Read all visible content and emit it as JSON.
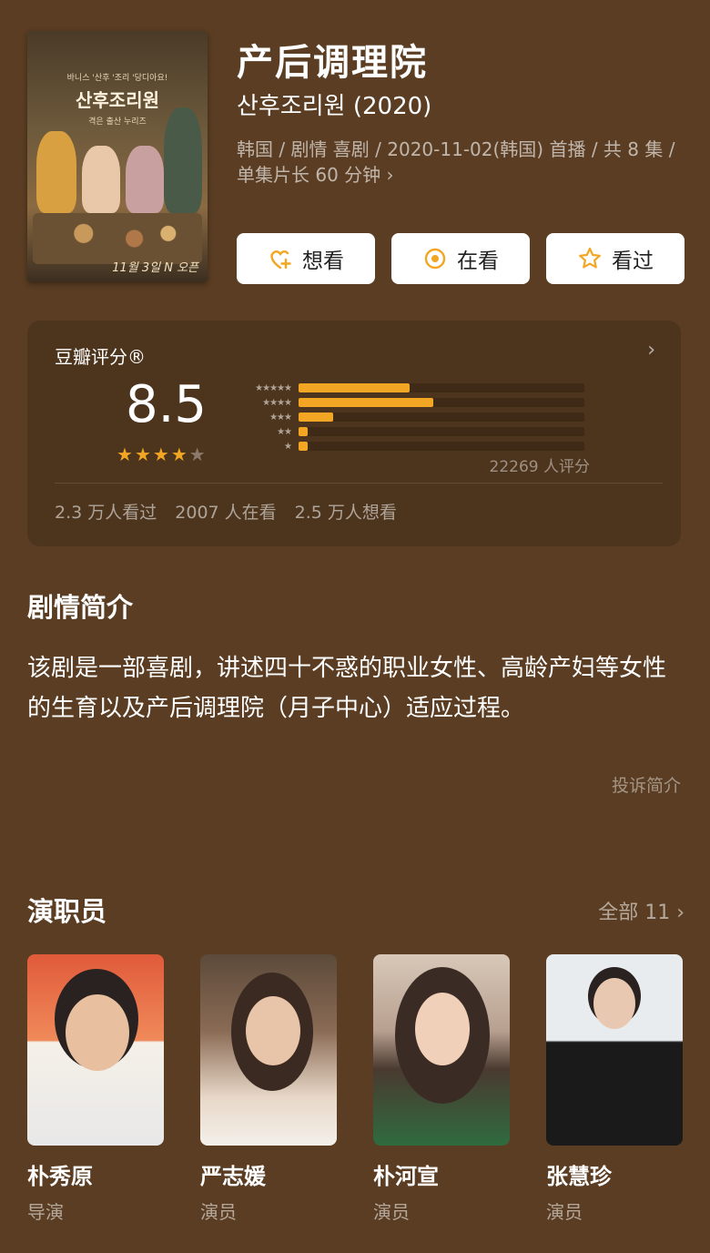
{
  "poster": {
    "korean_title": "산후조리원",
    "tagline": "바니스 '산후 '조리 '당디아요!",
    "subtitle": "격은 출산 누리즈",
    "date_text": "11월 3일 N 오픈"
  },
  "header": {
    "title": "产后调理院",
    "original_title": "산후조리원 (2020)",
    "meta": "韩国 / 剧情 喜剧 / 2020-11-02(韩国) 首播 / 共 8 集 / 单集片长 60 分钟 ›"
  },
  "actions": [
    {
      "label": "想看",
      "icon": "heart-plus-icon"
    },
    {
      "label": "在看",
      "icon": "target-icon"
    },
    {
      "label": "看过",
      "icon": "star-outline-icon"
    }
  ],
  "rating": {
    "label": "豆瓣评分®",
    "score": "8.5",
    "stars_filled": 4,
    "stars_total": 5,
    "count_text": "22269 人评分",
    "distribution": [
      {
        "stars": 5,
        "fraction": 0.39
      },
      {
        "stars": 4,
        "fraction": 0.47
      },
      {
        "stars": 3,
        "fraction": 0.12
      },
      {
        "stars": 2,
        "fraction": 0.03
      },
      {
        "stars": 1,
        "fraction": 0.03
      }
    ],
    "stats": [
      "2.3 万人看过",
      "2007 人在看",
      "2.5 万人想看"
    ]
  },
  "synopsis": {
    "heading": "剧情简介",
    "text": "该剧是一部喜剧，讲述四十不惑的职业女性、高龄产妇等女性的生育以及产后调理院（月子中心）适应过程。",
    "complain_label": "投诉简介"
  },
  "cast": {
    "heading": "演职员",
    "see_all": "全部 11 ›",
    "members": [
      {
        "name": "朴秀原",
        "role": "导演"
      },
      {
        "name": "严志媛",
        "role": "演员"
      },
      {
        "name": "朴河宣",
        "role": "演员"
      },
      {
        "name": "张慧珍",
        "role": "演员"
      }
    ]
  },
  "colors": {
    "background": "#5a3d22",
    "accent": "#f2a623"
  }
}
